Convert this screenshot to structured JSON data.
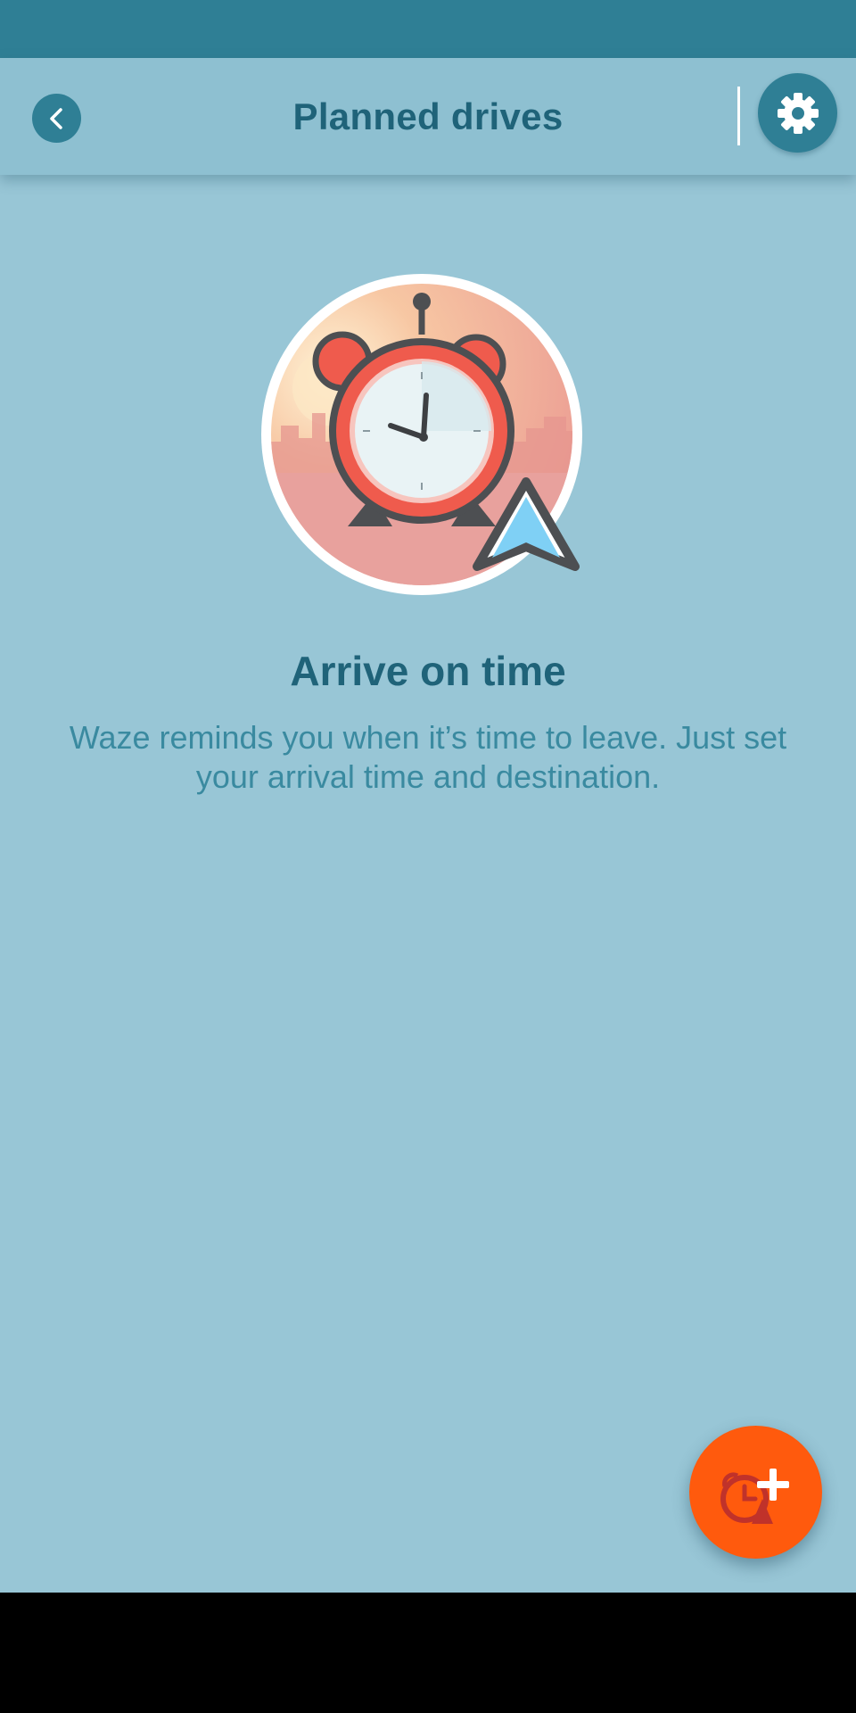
{
  "app_bar": {
    "title": "Planned drives",
    "back_icon": "chevron-left-icon",
    "settings_icon": "gear-icon"
  },
  "empty_state": {
    "illustration": "alarm-clock-navigation-illustration",
    "headline": "Arrive on time",
    "description": "Waze reminds you when it’s time to leave. Just set your arrival time and destination."
  },
  "fab": {
    "icon": "add-planned-drive-icon"
  },
  "colors": {
    "status_bar": "#2f7f95",
    "app_bar": "#8ec0d1",
    "background": "#98c6d6",
    "title_text": "#1f6379",
    "body_text": "#3a8aa0",
    "fab": "#ff5a0d"
  }
}
